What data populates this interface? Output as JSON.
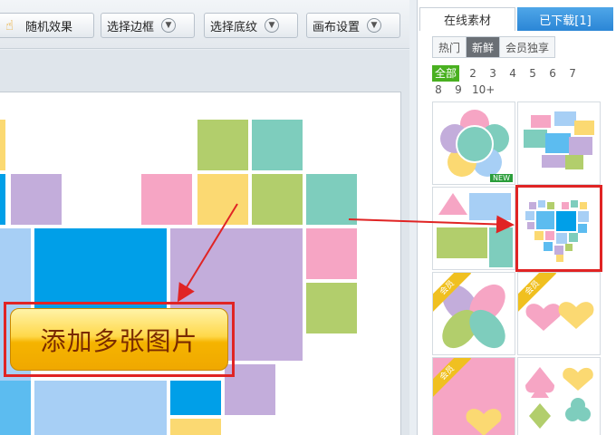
{
  "toolbar": {
    "buttons": [
      {
        "label": "随机效果",
        "icon": "hand-pointer-icon"
      },
      {
        "label": "选择边框",
        "icon": "chevron-down-icon"
      },
      {
        "label": "选择底纹",
        "icon": "chevron-down-icon"
      },
      {
        "label": "画布设置",
        "icon": "chevron-down-icon"
      }
    ]
  },
  "canvas": {
    "add_images_label": "添加多张图片"
  },
  "panel": {
    "tabs": [
      {
        "label": "在线素材",
        "active": true
      },
      {
        "label": "已下载[1]",
        "active": false
      }
    ],
    "subtabs": [
      {
        "label": "热门",
        "selected": false
      },
      {
        "label": "新鲜",
        "selected": true
      },
      {
        "label": "会员独享",
        "selected": false
      }
    ],
    "pages": [
      "全部",
      "2",
      "3",
      "4",
      "5",
      "6",
      "7",
      "8",
      "9",
      "10+"
    ],
    "selected_page": "全部",
    "thumbs": [
      {
        "badge": "NEW"
      },
      {
        "badge": ""
      },
      {
        "badge": ""
      },
      {
        "badge": "",
        "highlighted": true
      },
      {
        "badge": "会员"
      },
      {
        "badge": "会员"
      },
      {
        "badge": "会员"
      },
      {
        "badge": ""
      }
    ]
  },
  "colors": {
    "accent_blue": "#2b86d6",
    "highlight_red": "#e02424",
    "green": "#49b020",
    "cell_colors": [
      "#fbd972",
      "#b2ce6c",
      "#7ecdbd",
      "#c3addb",
      "#f6a5c4",
      "#009fe8",
      "#a7cff5",
      "#5cbcf0"
    ]
  }
}
